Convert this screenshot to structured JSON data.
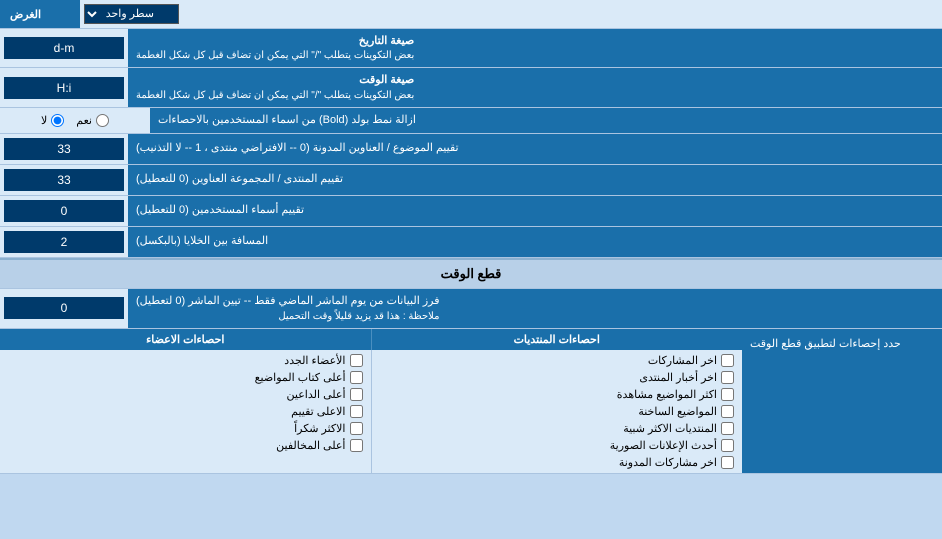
{
  "page": {
    "purpose_label": "الغرض",
    "purpose_option": "سطر واحد",
    "date_format_label": "صيغة التاريخ",
    "date_format_note": "بعض التكوينات يتطلب \"/\" التي يمكن ان تضاف قبل كل شكل الغطمة",
    "date_format_value": "d-m",
    "time_format_label": "صيغة الوقت",
    "time_format_note": "بعض التكوينات يتطلب \"/\" التي يمكن ان تضاف قبل كل شكل الغطمة",
    "time_format_value": "H:i",
    "bold_label": "ازالة نمط بولد (Bold) من اسماء المستخدمين بالاحصاءات",
    "bold_yes": "نعم",
    "bold_no": "لا",
    "bold_selected": "no",
    "topics_label": "تقييم الموضوع / العناوين المدونة (0 -- الافتراضي منتدى ، 1 -- لا التذنيب)",
    "topics_value": "33",
    "forum_label": "تقييم المنتدى / المجموعة العناوين (0 للتعطيل)",
    "forum_value": "33",
    "users_label": "تقييم أسماء المستخدمين (0 للتعطيل)",
    "users_value": "0",
    "distance_label": "المسافة بين الخلايا (بالبكسل)",
    "distance_value": "2",
    "section_time_label": "قطع الوقت",
    "filter_label": "فرز البيانات من يوم الماشر الماضي فقط -- تيين الماشر (0 لتعطيل)",
    "filter_note": "ملاحظة : هذا قد يزيد قليلاً وقت التحميل",
    "filter_value": "0",
    "stats_limit_label": "حدد إحصاءات لتطبيق قطع الوقت",
    "checkbox_headers": {
      "col1": "احصاءات المنتديات",
      "col2": "احصاءات الاعضاء"
    },
    "checkboxes_col1": [
      "اخر المشاركات",
      "اخر أخبار المنتدى",
      "اكثر المواضيع مشاهدة",
      "المواضيع الساخنة",
      "المنتديات الاكثر شبية",
      "أحدث الإعلانات الصورية",
      "اخر مشاركات المدونة"
    ],
    "checkboxes_col2": [
      "الأعضاء الجدد",
      "أعلى كتاب المواضيع",
      "أعلى الداعين",
      "الاعلى تقييم",
      "الاكثر شكراً",
      "أعلى المخالفين"
    ]
  }
}
